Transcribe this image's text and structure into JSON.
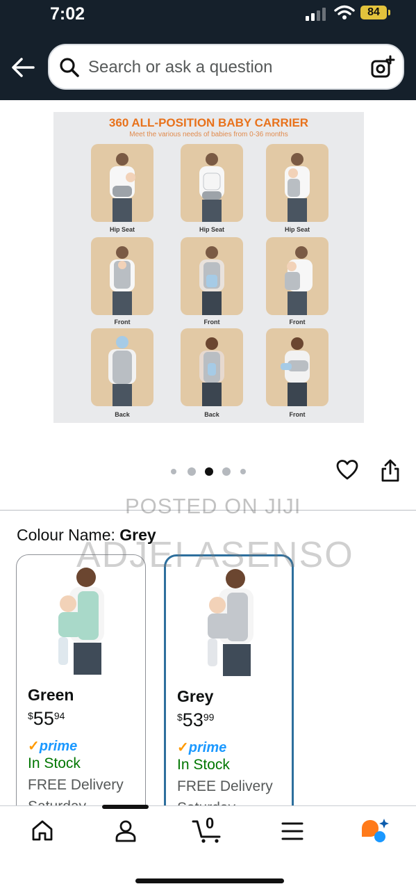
{
  "status_bar": {
    "time": "7:02",
    "battery": "84"
  },
  "search": {
    "placeholder": "Search or ask a question"
  },
  "hero_image": {
    "title": "360 ALL-POSITION BABY CARRIER",
    "subtitle": "Meet the various needs of babies from 0-36 months",
    "tiles": [
      {
        "label": "Hip Seat"
      },
      {
        "label": "Hip Seat"
      },
      {
        "label": "Hip Seat"
      },
      {
        "label": "Front"
      },
      {
        "label": "Front"
      },
      {
        "label": "Front"
      },
      {
        "label": "Back"
      },
      {
        "label": "Back"
      },
      {
        "label": "Front"
      }
    ]
  },
  "carousel": {
    "total": 5,
    "active_index": 2
  },
  "watermark": {
    "line1": "POSTED ON JIJI",
    "line2": "ADJEI ASENSO"
  },
  "colour": {
    "label": "Colour Name:",
    "selected": "Grey"
  },
  "swatches": [
    {
      "name": "Green",
      "currency": "$",
      "price_whole": "55",
      "price_fraction": "94",
      "prime": "prime",
      "stock": "In Stock",
      "delivery": "FREE Delivery",
      "delivery_day": "Saturday",
      "carrier_color": "#a9d9c9",
      "selected": false
    },
    {
      "name": "Grey",
      "currency": "$",
      "price_whole": "53",
      "price_fraction": "99",
      "prime": "prime",
      "stock": "In Stock",
      "delivery": "FREE Delivery",
      "delivery_day": "Saturday",
      "carrier_color": "#c3c7cc",
      "selected": true
    }
  ],
  "colors": {
    "topbar": "#15202b",
    "accent_orange": "#ff9900",
    "prime_blue": "#1a98ff",
    "stock_green": "#007600",
    "selected_border": "#2d6f9d"
  },
  "bottom_nav": [
    {
      "icon": "home-icon"
    },
    {
      "icon": "account-icon"
    },
    {
      "icon": "cart-icon",
      "badge": "0"
    },
    {
      "icon": "menu-icon"
    },
    {
      "icon": "rufus-ai-icon"
    }
  ]
}
